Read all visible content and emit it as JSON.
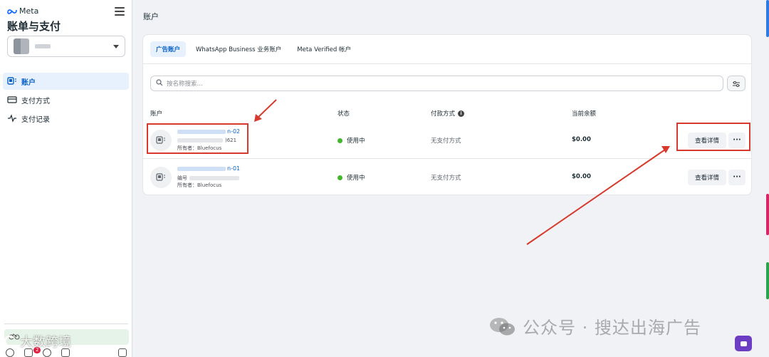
{
  "sidebar": {
    "brand": "Meta",
    "title": "账单与支付",
    "nav": [
      {
        "label": "账户",
        "icon": "accounts-icon"
      },
      {
        "label": "支付方式",
        "icon": "card-icon"
      },
      {
        "label": "支付记录",
        "icon": "activity-icon"
      }
    ],
    "notification_count": "2"
  },
  "main": {
    "heading": "账户",
    "tabs": [
      {
        "label": "广告账户",
        "active": true
      },
      {
        "label": "WhatsApp Business 业务账户",
        "active": false
      },
      {
        "label": "Meta Verified 帐户",
        "active": false
      }
    ],
    "search_placeholder": "按名称搜索...",
    "columns": [
      "账户",
      "状态",
      "付款方式",
      "当前余额"
    ],
    "rows": [
      {
        "name_suffix": "n-02",
        "id_suffix": ")621",
        "owner": "所有者：Bluefocus",
        "status": "使用中",
        "payment": "无支付方式",
        "balance": "$0.00",
        "detail_label": "查看详情",
        "more_label": "···"
      },
      {
        "name_suffix": "n-01",
        "id_prefix": "编号",
        "owner": "所有者：Bluefocus",
        "status": "使用中",
        "payment": "无支付方式",
        "balance": "$0.00",
        "detail_label": "查看详情",
        "more_label": "···"
      }
    ]
  },
  "colors": {
    "accent": "#0a62c9",
    "highlight": "#d73a2c",
    "status_active": "#42b72a"
  },
  "watermarks": {
    "right": "公众号 · 搜达出海广告",
    "left": "大数跨境"
  }
}
